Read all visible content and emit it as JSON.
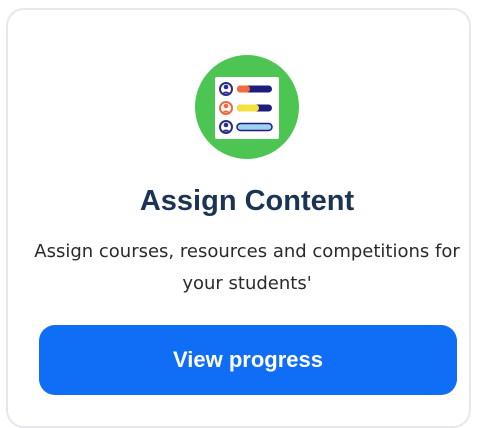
{
  "card": {
    "title": "Assign Content",
    "description": "Assign courses, resources and competitions for your students'",
    "button_label": "View progress",
    "icon": "assign-list-icon"
  },
  "colors": {
    "icon_circle": "#4cc552",
    "title": "#1b3453",
    "button": "#0f6ef5",
    "button_text": "#ffffff"
  }
}
